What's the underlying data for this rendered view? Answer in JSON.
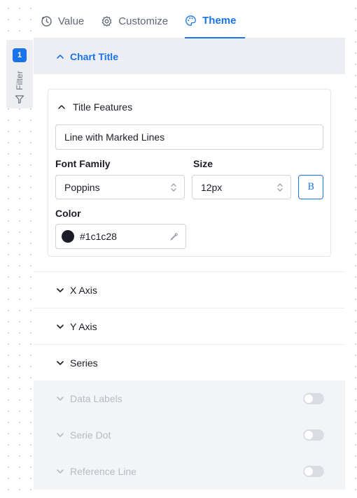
{
  "filter": {
    "badge": "1",
    "label": "Filter"
  },
  "tabs": [
    {
      "label": "Value",
      "icon": "clock-icon",
      "active": false
    },
    {
      "label": "Customize",
      "icon": "gear-icon",
      "active": false
    },
    {
      "label": "Theme",
      "icon": "palette-icon",
      "active": true
    }
  ],
  "chart_title_section": {
    "label": "Chart Title",
    "expanded": true
  },
  "title_features": {
    "label": "Title Features",
    "title_value": "Line with Marked Lines",
    "font_family_label": "Font Family",
    "font_family_value": "Poppins",
    "size_label": "Size",
    "size_value": "12px",
    "bold_label": "B",
    "color_label": "Color",
    "color_hex": "#1c1c28"
  },
  "accordions": [
    {
      "label": "X Axis"
    },
    {
      "label": "Y Axis"
    },
    {
      "label": "Series"
    }
  ],
  "disabled_sections": [
    {
      "label": "Data Labels",
      "toggle": false
    },
    {
      "label": "Serie Dot",
      "toggle": false
    },
    {
      "label": "Reference Line",
      "toggle": false
    }
  ],
  "colors": {
    "accent": "#1a73e8",
    "text": "#1c1c28",
    "muted": "#b5bac4"
  }
}
